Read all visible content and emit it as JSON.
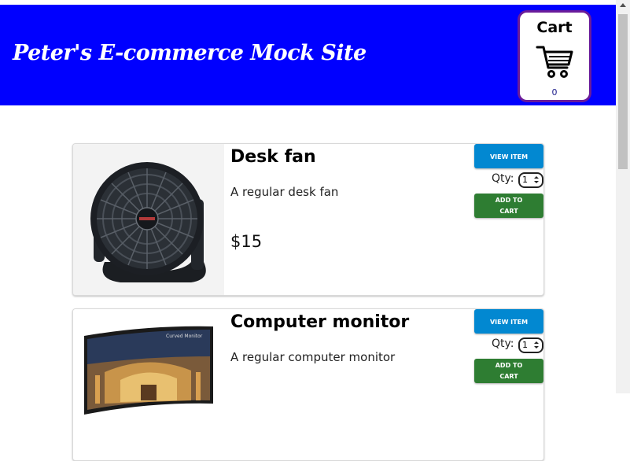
{
  "header": {
    "site_title": "Peter's E-commerce Mock Site",
    "cart_label": "Cart",
    "cart_count": "0",
    "background_color": "#0000ff"
  },
  "products": [
    {
      "name": "Desk fan",
      "description": "A regular desk fan",
      "price": "$15",
      "view_label": "VIEW ITEM",
      "qty_label": "Qty:",
      "qty_value": "1",
      "add_label_line1": "ADD TO",
      "add_label_line2": "CART"
    },
    {
      "name": "Computer monitor",
      "description": "A regular computer monitor",
      "view_label": "VIEW ITEM",
      "qty_label": "Qty:",
      "qty_value": "1",
      "add_label_line1": "ADD TO",
      "add_label_line2": "CART"
    }
  ],
  "colors": {
    "view_button": "#0288d1",
    "add_button": "#2e7d32",
    "cart_border": "#6a1b9a"
  }
}
